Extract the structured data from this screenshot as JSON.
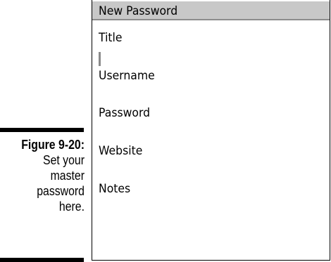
{
  "caption": {
    "figure_label": "Figure 9-20:",
    "lines": [
      "Set your",
      "master",
      "password",
      "here."
    ]
  },
  "dialog": {
    "title": "New Password",
    "fields": [
      {
        "label": "Title",
        "value": ""
      },
      {
        "label": "Username",
        "value": ""
      },
      {
        "label": "Password",
        "value": ""
      },
      {
        "label": "Website",
        "value": ""
      },
      {
        "label": "Notes",
        "value": ""
      }
    ]
  },
  "colors": {
    "titlebar_bg": "#c8c8c8",
    "caret": "#8a8a8a"
  }
}
